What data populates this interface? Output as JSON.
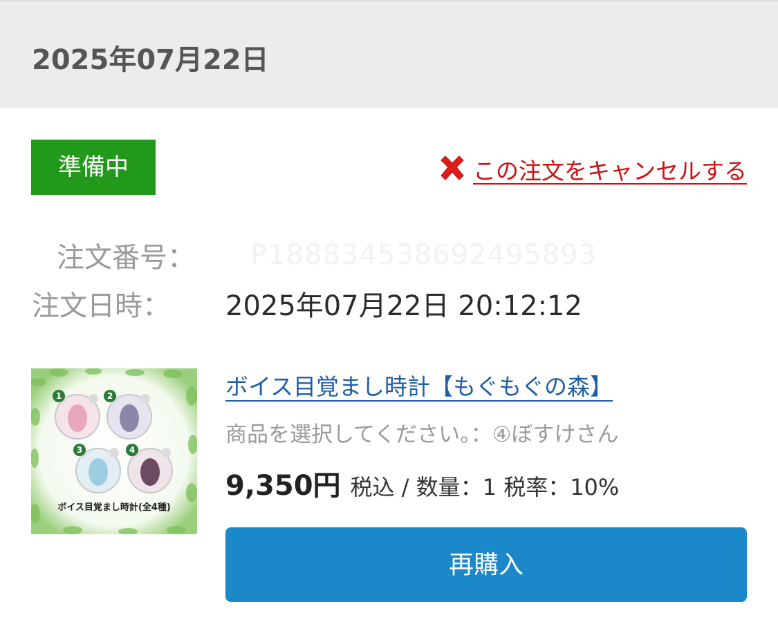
{
  "header": {
    "date": "2025年07月22日"
  },
  "order": {
    "status": "準備中",
    "cancel_label": "この注文をキャンセルする",
    "number_label": "注文番号：",
    "number_value": "P188834538692495893",
    "datetime_label": "注文日時：",
    "datetime_value": "2025年07月22日 20:12:12"
  },
  "product": {
    "title": "ボイス目覚まし時計【もぐもぐの森】",
    "option": "商品を選択してください。：④ぼすけさん",
    "price": "9,350円",
    "price_detail": "税込 / 数量：1 税率：10%",
    "image_caption": "ボイス目覚まし時計(全4種)",
    "image_numbers": [
      "1",
      "2",
      "3",
      "4"
    ]
  },
  "actions": {
    "rebuy_label": "再購入"
  },
  "colors": {
    "status_green": "#22991a",
    "cancel_red": "#cc1111",
    "link_blue": "#1f5ea8",
    "button_blue": "#1a88c9"
  }
}
